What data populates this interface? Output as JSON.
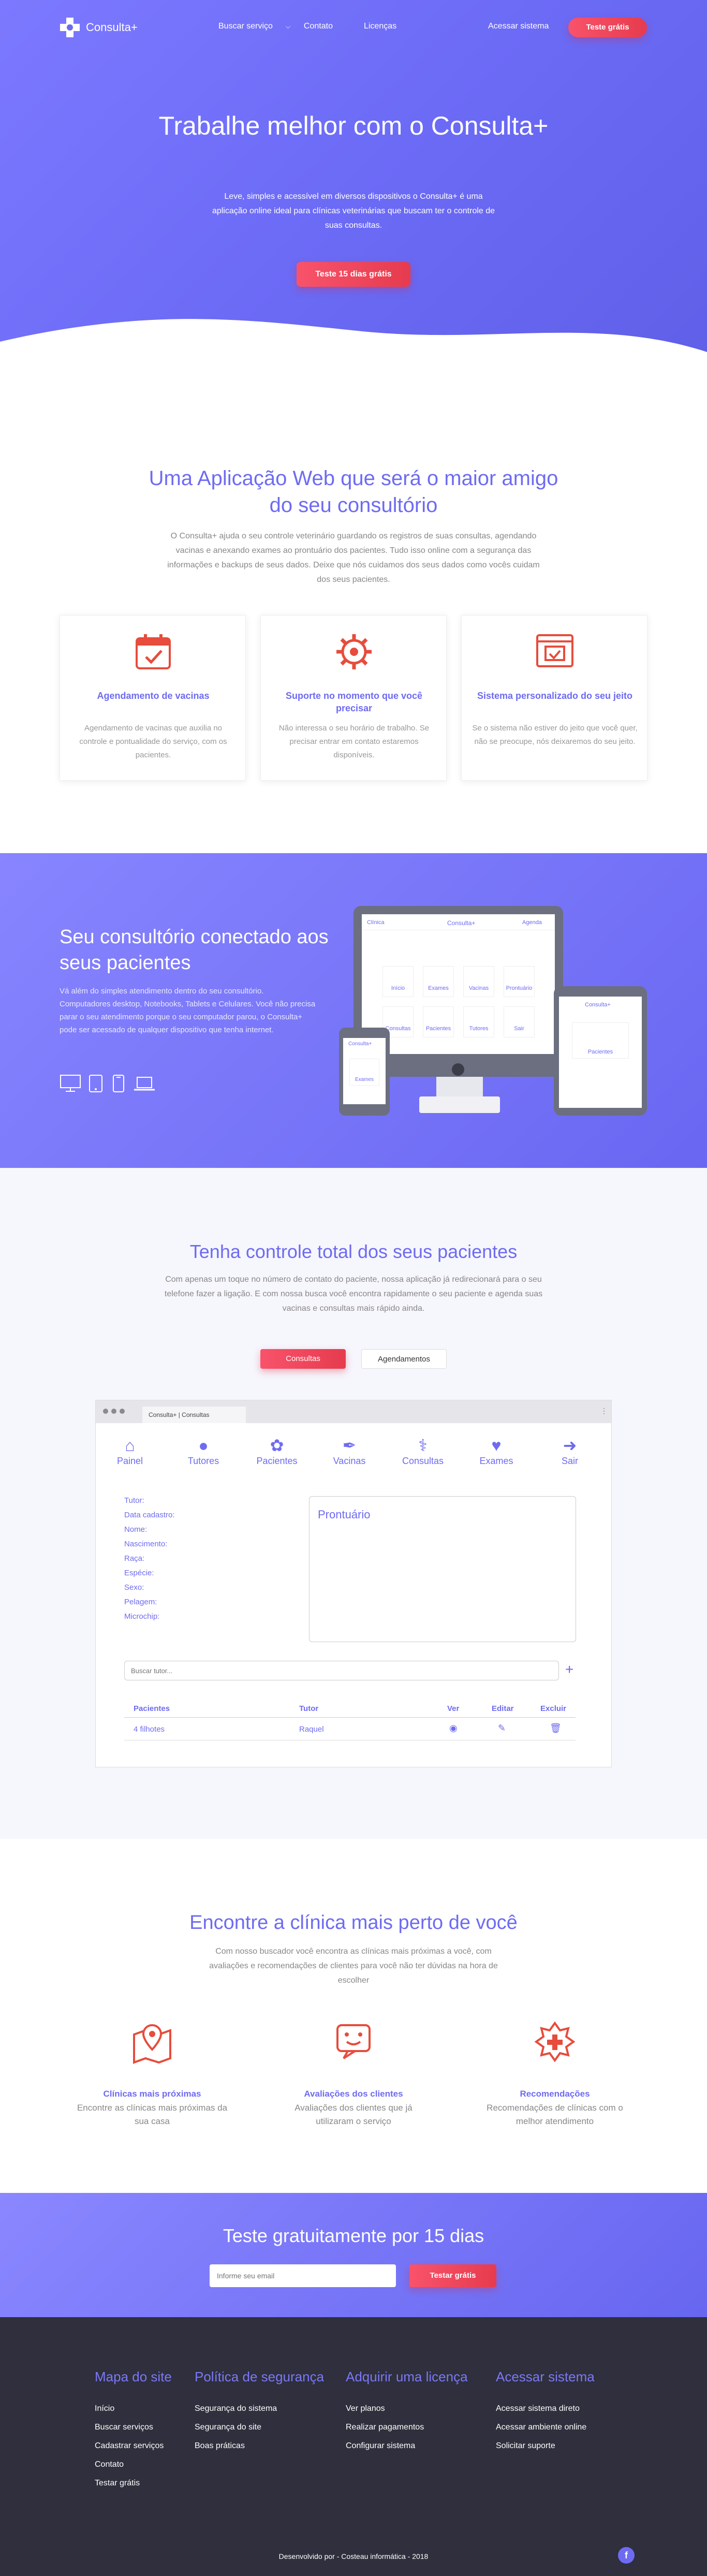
{
  "nav": {
    "logo": "Consulta+",
    "links": [
      "Buscar serviço",
      "Contato",
      "Licenças"
    ],
    "login": "Acessar sistema",
    "cta": "Teste grátis"
  },
  "hero": {
    "title": "Trabalhe melhor com o Consulta+",
    "text": "Leve, simples e acessível em diversos dispositivos o Consulta+ é uma aplicação online ideal para clínicas veterinárias que buscam ter o controle de suas consultas.",
    "cta": "Teste 15 dias grátis"
  },
  "about": {
    "title": "Uma Aplicação Web que será o maior amigo do seu consultório",
    "text": "O Consulta+ ajuda o seu controle veterinário guardando os registros de suas consultas, agendando vacinas e anexando exames ao prontuário dos pacientes. Tudo isso online com a segurança das informações e backups de seus dados. Deixe que nós cuidamos dos seus dados como vocês cuidam dos seus pacientes.",
    "cards": [
      {
        "icon": "calendar-icon",
        "title": "Agendamento de vacinas",
        "text": "Agendamento de vacinas que auxilia no controle e pontualidade do serviço, com os pacientes."
      },
      {
        "icon": "gear-icon",
        "title": "Suporte no momento que você precisar",
        "text": "Não interessa o seu horário de trabalho. Se precisar entrar em contato estaremos disponíveis."
      },
      {
        "icon": "browser-icon",
        "title": "Sistema personalizado do seu jeito",
        "text": "Se o sistema não estiver do jeito que você quer, não se preocupe, nós deixaremos do seu jeito."
      }
    ]
  },
  "connected": {
    "title": "Seu consultório conectado aos seus pacientes",
    "text": "Vá além do simples atendimento dentro do seu consultório. Computadores desktop, Notebooks, Tablets e Celulares. Você não precisa parar o seu atendimento porque o seu computador parou, o Consulta+ pode ser acessado de qualquer dispositivo que tenha internet.",
    "devices": [
      "desktop-icon",
      "tablet-icon",
      "phone-icon",
      "laptop-icon"
    ],
    "mock": {
      "desktop_logo": "Consulta+",
      "desktop_left": "Clínica",
      "desktop_right": "Agenda",
      "tiles": [
        "Início",
        "Exames",
        "Vacinas",
        "Prontuário",
        "Consultas",
        "Pacientes",
        "Tutores",
        "Sair"
      ],
      "tablet_tile": "Pacientes",
      "phone_logo": "Consulta+",
      "phone_tile": "Exames"
    }
  },
  "control": {
    "title": "Tenha controle total dos seus pacientes",
    "text": "Com apenas um toque no número de contato do paciente, nossa aplicação já redirecionará para o seu telefone fazer a ligação. E com nossa busca você encontra rapidamente o seu paciente e agenda suas vacinas e consultas mais rápido ainda.",
    "tabs": [
      "Consultas",
      "Agendamentos"
    ],
    "browser_tab": "Consulta+ | Consultas",
    "toolbar": [
      {
        "icon": "home-icon",
        "label": "Painel"
      },
      {
        "icon": "user-icon",
        "label": "Tutores"
      },
      {
        "icon": "paw-icon",
        "label": "Pacientes"
      },
      {
        "icon": "syringe-icon",
        "label": "Vacinas"
      },
      {
        "icon": "stethoscope-icon",
        "label": "Consultas"
      },
      {
        "icon": "heartbeat-icon",
        "label": "Exames"
      },
      {
        "icon": "exit-icon",
        "label": "Sair"
      }
    ],
    "fields": [
      "Tutor:",
      "Data cadastro:",
      "Nome:",
      "Nascimento:",
      "Raça:",
      "Espécie:",
      "Sexo:",
      "Pelagem:",
      "Microchip:"
    ],
    "record_title": "Prontuário",
    "search_placeholder": "Buscar tutor...",
    "table_headers": [
      "Pacientes",
      "Tutor",
      "Ver",
      "Editar",
      "Excluir"
    ],
    "rows": [
      {
        "patient": "4 filhotes",
        "tutor": "Raquel"
      }
    ]
  },
  "clinic": {
    "title": "Encontre a clínica mais perto de você",
    "text": "Com nosso buscador você encontra as clínicas mais próximas a você, com avaliações e recomendações de clientes para você não ter dúvidas na hora de escolher",
    "items": [
      {
        "icon": "map-pin-icon",
        "title": "Clínicas mais próximas",
        "text": "Encontre as clínicas mais próximas da sua casa"
      },
      {
        "icon": "rating-icon",
        "title": "Avaliações dos clientes",
        "text": "Avaliações dos clientes que já utilizaram o serviço"
      },
      {
        "icon": "cross-icon",
        "title": "Recomendações",
        "text": "Recomendações de clínicas com o melhor atendimento"
      }
    ]
  },
  "trial": {
    "title": "Teste gratuitamente por 15 dias",
    "placeholder": "Informe seu email",
    "cta": "Testar grátis"
  },
  "footer": {
    "columns": [
      {
        "title": "Mapa do site",
        "links": [
          "Início",
          "Buscar serviços",
          "Cadastrar serviços",
          "Contato",
          "Testar grátis"
        ]
      },
      {
        "title": "Política de segurança",
        "links": [
          "Segurança do sistema",
          "Segurança do site",
          "Boas práticas"
        ]
      },
      {
        "title": "Adquirir uma licença",
        "links": [
          "Ver planos",
          "Realizar pagamentos",
          "Configurar sistema"
        ]
      },
      {
        "title": "Acessar sistema",
        "links": [
          "Acessar sistema direto",
          "Acessar ambiente online",
          "Solicitar suporte"
        ]
      }
    ],
    "credit": "Desenvolvido por - Costeau informática - 2018",
    "social": "facebook-icon"
  },
  "colors": {
    "primary": "#6e6bf2",
    "accent": "#f04a5e",
    "footer": "#2f2f3d"
  }
}
